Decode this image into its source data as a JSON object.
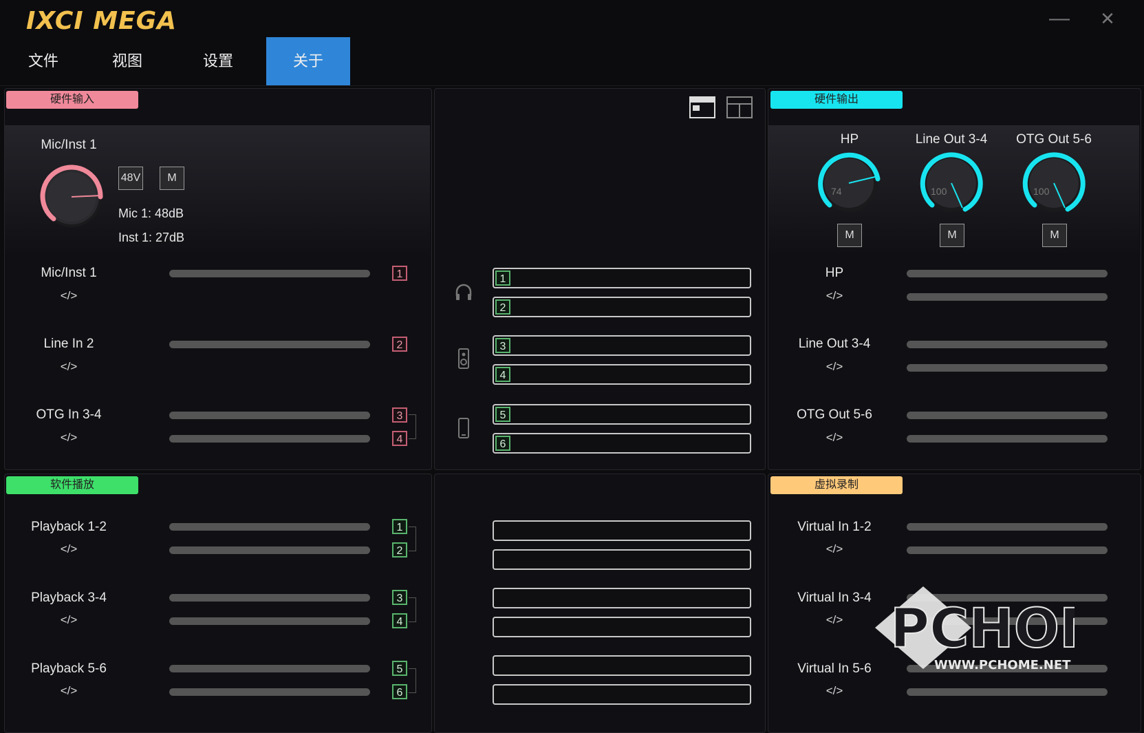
{
  "app": {
    "logo": "IXCI MEGA",
    "minimize_glyph": "—",
    "close_glyph": "✕"
  },
  "menu": [
    {
      "label": "文件"
    },
    {
      "label": "视图"
    },
    {
      "label": "设置"
    },
    {
      "label": "关于"
    }
  ],
  "hw_input": {
    "badge": "硬件输入",
    "channel_title": "Mic/Inst 1",
    "phantom_label": "48V",
    "mute_label": "M",
    "mic_gain": "Mic 1: 48dB",
    "inst_gain": "Inst 1: 27dB",
    "rows": [
      {
        "name": "Mic/Inst 1",
        "code": "</>",
        "nums": [
          "1"
        ]
      },
      {
        "name": "Line In 2",
        "code": "</>",
        "nums": [
          "2"
        ]
      },
      {
        "name": "OTG In 3-4",
        "code": "</>",
        "nums": [
          "3",
          "4"
        ]
      }
    ]
  },
  "routing_top": {
    "boxes": [
      "1",
      "2",
      "3",
      "4",
      "5",
      "6"
    ]
  },
  "hw_output": {
    "badge": "硬件输出",
    "dials": [
      {
        "name": "HP",
        "value": "74",
        "mute": "M"
      },
      {
        "name": "Line Out 3-4",
        "value": "100",
        "mute": "M"
      },
      {
        "name": "OTG Out 5-6",
        "value": "100",
        "mute": "M"
      }
    ],
    "rows": [
      {
        "name": "HP",
        "code": "</>"
      },
      {
        "name": "Line Out 3-4",
        "code": "</>"
      },
      {
        "name": "OTG Out 5-6",
        "code": "</>"
      }
    ]
  },
  "sw_playback": {
    "badge": "软件播放",
    "rows": [
      {
        "name": "Playback 1-2",
        "code": "</>",
        "nums": [
          "1",
          "2"
        ]
      },
      {
        "name": "Playback 3-4",
        "code": "</>",
        "nums": [
          "3",
          "4"
        ]
      },
      {
        "name": "Playback 5-6",
        "code": "</>",
        "nums": [
          "5",
          "6"
        ]
      }
    ]
  },
  "virtual_rec": {
    "badge": "虚拟录制",
    "rows": [
      {
        "name": "Virtual In 1-2",
        "code": "</>"
      },
      {
        "name": "Virtual In 3-4",
        "code": "</>"
      },
      {
        "name": "Virtual In 5-6",
        "code": "</>"
      }
    ]
  },
  "watermark": {
    "brand": "PCHOME",
    "url": "WWW.PCHOME.NET"
  },
  "colors": {
    "accent_blue": "#2f86d8",
    "input_pink": "#f0899a",
    "output_cyan": "#18e4f0",
    "playback_green": "#3ee06a",
    "virtual_orange": "#ffc97a"
  }
}
